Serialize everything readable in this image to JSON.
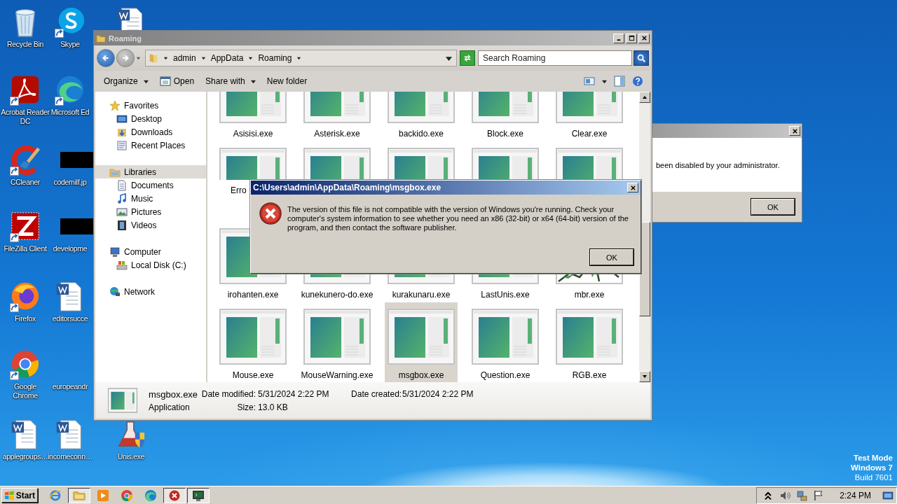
{
  "desktop": {
    "icons": [
      {
        "label": "Recycle Bin",
        "kind": "recycle",
        "shortcut": false
      },
      {
        "label": "Acrobat Reader DC",
        "kind": "acrobat",
        "shortcut": true
      },
      {
        "label": "CCleaner",
        "kind": "ccleaner",
        "shortcut": true
      },
      {
        "label": "FileZilla Client",
        "kind": "filezilla",
        "shortcut": true
      },
      {
        "label": "Firefox",
        "kind": "firefox",
        "shortcut": true
      },
      {
        "label": "Google Chrome",
        "kind": "chrome",
        "shortcut": true
      },
      {
        "label": "applegroups…",
        "kind": "word",
        "shortcut": false
      },
      {
        "label": "Skype",
        "kind": "skype",
        "shortcut": true
      },
      {
        "label": "Microsoft Ed",
        "kind": "edge",
        "shortcut": true
      },
      {
        "label": "codemilf.jp",
        "kind": "redacted",
        "shortcut": false
      },
      {
        "label": "developme",
        "kind": "redacted",
        "shortcut": false
      },
      {
        "label": "editorsucce",
        "kind": "word",
        "shortcut": false
      },
      {
        "label": "europeandr",
        "kind": "none",
        "shortcut": false
      },
      {
        "label": "incomeconn…",
        "kind": "word",
        "shortcut": false
      },
      {
        "kind": "word",
        "shortcut": false
      },
      {
        "label": "Unis.exe",
        "kind": "unis",
        "shortcut": false
      }
    ]
  },
  "background_dialog": {
    "message": "been disabled by your administrator.",
    "button": "OK"
  },
  "explorer": {
    "title": "Roaming",
    "breadcrumb": [
      "admin",
      "AppData",
      "Roaming"
    ],
    "search": {
      "placeholder": "Search Roaming"
    },
    "toolbar": [
      {
        "label": "Organize",
        "kind": "menu"
      },
      {
        "label": "Open",
        "kind": "open"
      },
      {
        "label": "Share with",
        "kind": "menu"
      },
      {
        "label": "New folder",
        "kind": "plain"
      }
    ],
    "nav": [
      {
        "label": "Favorites",
        "kind": "star",
        "selected": false,
        "children": [
          {
            "label": "Desktop",
            "kind": "desktop",
            "selected": false
          },
          {
            "label": "Downloads",
            "kind": "downloads",
            "selected": false
          },
          {
            "label": "Recent Places",
            "kind": "recent",
            "selected": false
          }
        ]
      },
      {
        "label": "Libraries",
        "kind": "library",
        "selected": true,
        "children": [
          {
            "label": "Documents",
            "kind": "documents",
            "selected": false
          },
          {
            "label": "Music",
            "kind": "music",
            "selected": false
          },
          {
            "label": "Pictures",
            "kind": "pictures",
            "selected": false
          },
          {
            "label": "Videos",
            "kind": "videos",
            "selected": false
          }
        ]
      },
      {
        "label": "Computer",
        "kind": "computer",
        "selected": false,
        "children": [
          {
            "label": "Local Disk (C:)",
            "kind": "disk",
            "selected": false
          }
        ]
      },
      {
        "label": "Network",
        "kind": "network",
        "selected": false
      }
    ],
    "files": [
      {
        "label": "Asisisi.exe",
        "kind": "app",
        "selected": false
      },
      {
        "label": "Asterisk.exe",
        "kind": "app",
        "selected": false
      },
      {
        "label": "backido.exe",
        "kind": "app",
        "selected": false
      },
      {
        "label": "Block.exe",
        "kind": "app",
        "selected": false
      },
      {
        "label": "Clear.exe",
        "kind": "app",
        "selected": false
      },
      {
        "label": "Erro",
        "kind": "app",
        "selected": false
      },
      {
        "kind": "app",
        "selected": false
      },
      {
        "kind": "app",
        "selected": false
      },
      {
        "kind": "app",
        "selected": false
      },
      {
        "kind": "app",
        "selected": false
      },
      {
        "label": "irohanten.exe",
        "kind": "app",
        "selected": false
      },
      {
        "label": "kunekunero-do.exe",
        "kind": "app",
        "selected": false
      },
      {
        "label": "kurakunaru.exe",
        "kind": "app",
        "selected": false
      },
      {
        "label": "LastUnis.exe",
        "kind": "app",
        "selected": false
      },
      {
        "label": "mbr.exe",
        "kind": "crack",
        "selected": false
      },
      {
        "label": "Mouse.exe",
        "kind": "app",
        "selected": false
      },
      {
        "label": "MouseWarning.exe",
        "kind": "app",
        "selected": false
      },
      {
        "label": "msgbox.exe",
        "kind": "app",
        "selected": true
      },
      {
        "label": "Question.exe",
        "kind": "app",
        "selected": false
      },
      {
        "label": "RGB.exe",
        "kind": "app",
        "selected": false
      }
    ],
    "details": {
      "name": "msgbox.exe",
      "type": "Application",
      "fields": [
        {
          "label": "Date modified:",
          "value": "5/31/2024 2:22 PM"
        },
        {
          "label": "Date created:",
          "value": "5/31/2024 2:22 PM"
        },
        {
          "label": "Size:",
          "value": "13.0 KB"
        }
      ]
    }
  },
  "error_dialog": {
    "title": "C:\\Users\\admin\\AppData\\Roaming\\msgbox.exe",
    "message": "The version of this file is not compatible with the version of Windows you're running. Check your computer's system information to see whether you need an x86 (32-bit) or x64 (64-bit) version of the program, and then contact the software publisher.",
    "button": "OK"
  },
  "test_mode": [
    {
      "text": "Test Mode",
      "bold": true
    },
    {
      "text": "Windows 7",
      "bold": true
    },
    {
      "text": "Build 7601",
      "bold": false
    }
  ],
  "taskbar": {
    "start": "Start",
    "items": [
      {
        "kind": "ie",
        "active": false
      },
      {
        "kind": "explorer",
        "active": true
      },
      {
        "kind": "media",
        "active": false
      },
      {
        "kind": "chrome",
        "active": false
      },
      {
        "kind": "edge",
        "active": false
      },
      {
        "kind": "error",
        "active": true
      },
      {
        "kind": "terminal",
        "active": true
      }
    ],
    "clock": "2:24 PM"
  }
}
